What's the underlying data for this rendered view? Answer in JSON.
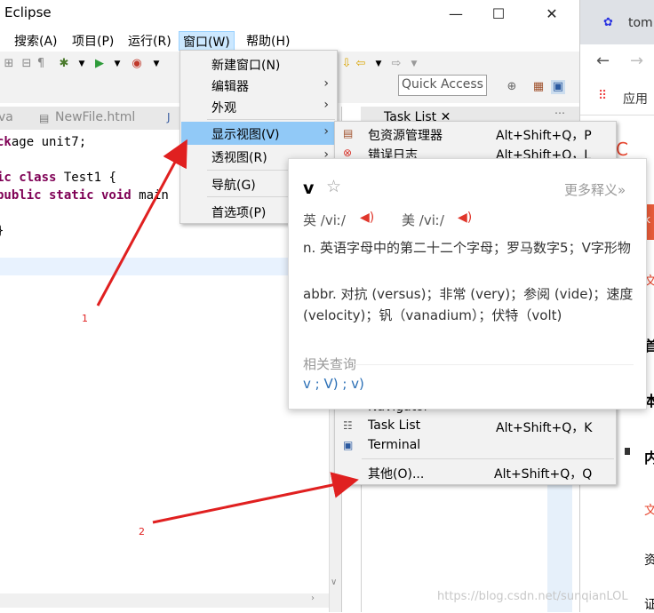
{
  "window": {
    "title": "Eclipse",
    "controls": {
      "minimize": "—",
      "maximize": "☐",
      "close": "✕"
    }
  },
  "menubar": {
    "items": [
      "搜索(A)",
      "项目(P)",
      "运行(R)",
      "窗口(W)",
      "帮助(H)"
    ],
    "active": "窗口(W)"
  },
  "toolbar": {
    "quick_access": "Quick Access"
  },
  "editor": {
    "tabs": [
      "va",
      "NewFile.html"
    ],
    "code_lines": [
      {
        "prefix": "",
        "kw": "",
        "text": "age unit7;"
      },
      {
        "prefix": "",
        "kw": "ic class",
        "text": " Test1 {"
      },
      {
        "prefix": "",
        "kw": "public static void",
        "text": " main"
      },
      {
        "prefix": "",
        "kw": "",
        "text": "}"
      }
    ]
  },
  "right_pane": {
    "tab": "Task List ✕"
  },
  "window_menu": {
    "items": [
      {
        "label": "新建窗口(N)",
        "submenu": false
      },
      {
        "label": "编辑器",
        "submenu": true
      },
      {
        "label": "外观",
        "submenu": true
      },
      {
        "label": "显示视图(V)",
        "submenu": true,
        "selected": true
      },
      {
        "label": "透视图(R)",
        "submenu": true
      },
      {
        "label": "导航(G)",
        "submenu": true
      },
      {
        "label": "首选项(P)",
        "submenu": false
      }
    ]
  },
  "show_view_submenu": {
    "items": [
      {
        "label": "包资源管理器",
        "shortcut": "Alt+Shift+Q，P",
        "icon": "package-explorer-icon"
      },
      {
        "label": "错误日志",
        "shortcut": "Alt+Shift+Q，L",
        "icon": "error-log-icon"
      },
      {
        "label": "Navigator",
        "shortcut": "",
        "icon": "navigator-icon"
      },
      {
        "label": "Task List",
        "shortcut": "Alt+Shift+Q，K",
        "icon": "task-list-icon"
      },
      {
        "label": "Terminal",
        "shortcut": "",
        "icon": "terminal-icon"
      },
      {
        "label": "其他(O)...",
        "shortcut": "Alt+Shift+Q，Q",
        "icon": ""
      }
    ]
  },
  "dictionary_popup": {
    "word": "v",
    "more": "更多释义»",
    "uk_label": "英 /viː/",
    "us_label": "美 /viː/",
    "definition_n": "n. 英语字母中的第二十二个字母；罗马数字5；V字形物",
    "definition_abbr": "abbr. 对抗 (versus)；非常 (very)；参阅 (vide)；速度 (velocity)；钒（vanadium）；伏特（volt)",
    "related_title": "相关查询",
    "related": "v ; V) ; v)"
  },
  "browser": {
    "tab_title": "tom",
    "bookmark": "应用",
    "content_snippets": [
      "C",
      "k",
      "文",
      "首",
      "本",
      "内",
      "文",
      "资",
      "证"
    ]
  },
  "annotations": {
    "label1": "1",
    "label2": "2"
  },
  "watermark": "https://blog.csdn.net/sunqianLOL",
  "colors": {
    "arrow": "#e02020",
    "menu_selected": "#91c9f7",
    "keyword": "#7f0055"
  }
}
